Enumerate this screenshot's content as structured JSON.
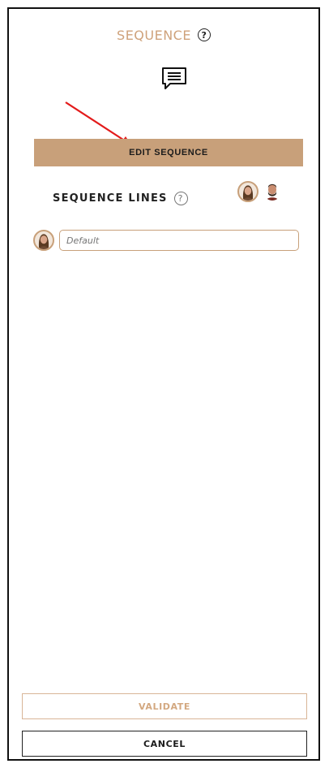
{
  "header": {
    "title": "SEQUENCE",
    "help_icon": "question-circle-icon",
    "title_color": "#cfa27b"
  },
  "chat_icon": "speech-bubble-icon",
  "annotation": {
    "icon": "red-arrow",
    "color": "#e31b1b"
  },
  "edit_button": {
    "label": "EDIT SEQUENCE",
    "bg": "#c8a07a"
  },
  "sequence_lines": {
    "title": "SEQUENCE LINES",
    "help_icon": "question-circle-icon",
    "characters": [
      {
        "name": "female-avatar",
        "selected": true
      },
      {
        "name": "male-avatar",
        "selected": false
      }
    ],
    "lines": [
      {
        "character": "female-avatar",
        "value": "",
        "placeholder": "Default"
      }
    ]
  },
  "footer": {
    "validate_label": "VALIDATE",
    "cancel_label": "CANCEL"
  }
}
